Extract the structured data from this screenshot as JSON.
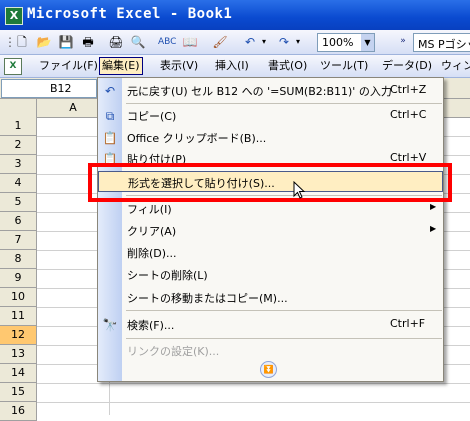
{
  "window": {
    "title": "Microsoft Excel - Book1",
    "app_icon": "excel-icon"
  },
  "toolbar": {
    "buttons": [
      "new-icon",
      "open-icon",
      "save-icon",
      "permission-icon",
      "print-icon",
      "print-preview-icon",
      "spelling-icon",
      "research-icon",
      "format-painter-icon",
      "undo-icon",
      "redo-icon"
    ],
    "zoom": "100%",
    "font": "MS Pゴシック"
  },
  "menubar": {
    "items": [
      {
        "label": "ファイル(F)"
      },
      {
        "label": "編集(E)"
      },
      {
        "label": "表示(V)"
      },
      {
        "label": "挿入(I)"
      },
      {
        "label": "書式(O)"
      },
      {
        "label": "ツール(T)"
      },
      {
        "label": "データ(D)"
      },
      {
        "label": "ウィン"
      }
    ],
    "active_index": 1
  },
  "formula_bar": {
    "name_box": "B12"
  },
  "grid": {
    "column_headers": [
      "A"
    ],
    "row_headers": [
      "1",
      "2",
      "3",
      "4",
      "5",
      "6",
      "7",
      "8",
      "9",
      "10",
      "11",
      "12",
      "13",
      "14",
      "15",
      "16"
    ],
    "selected_row": "12"
  },
  "edit_menu": {
    "items": [
      {
        "label": "元に戻す(U) セル B12 への '=SUM(B2:B11)' の入力",
        "shortcut": "Ctrl+Z",
        "icon": "undo-icon"
      },
      {
        "label": "コピー(C)",
        "shortcut": "Ctrl+C",
        "icon": "copy-icon"
      },
      {
        "label": "Office クリップボード(B)...",
        "shortcut": "",
        "icon": "clipboard-icon"
      },
      {
        "label": "貼り付け(P)",
        "shortcut": "Ctrl+V",
        "icon": "paste-icon"
      },
      {
        "label": "形式を選択して貼り付け(S)...",
        "shortcut": "",
        "icon": ""
      },
      {
        "label": "フィル(I)",
        "shortcut": "",
        "icon": ""
      },
      {
        "label": "クリア(A)",
        "shortcut": "",
        "icon": ""
      },
      {
        "label": "削除(D)...",
        "shortcut": "",
        "icon": ""
      },
      {
        "label": "シートの削除(L)",
        "shortcut": "",
        "icon": ""
      },
      {
        "label": "シートの移動またはコピー(M)...",
        "shortcut": "",
        "icon": ""
      },
      {
        "label": "検索(F)...",
        "shortcut": "Ctrl+F",
        "icon": "find-icon"
      },
      {
        "label": "リンクの設定(K)...",
        "shortcut": "",
        "icon": ""
      }
    ],
    "highlighted_index": 4,
    "expand": "chevron-double-down-icon"
  },
  "colors": {
    "highlight_border": "#ff0000",
    "menu_hover": "#ffeec2",
    "selected_row": "#ffc870"
  }
}
